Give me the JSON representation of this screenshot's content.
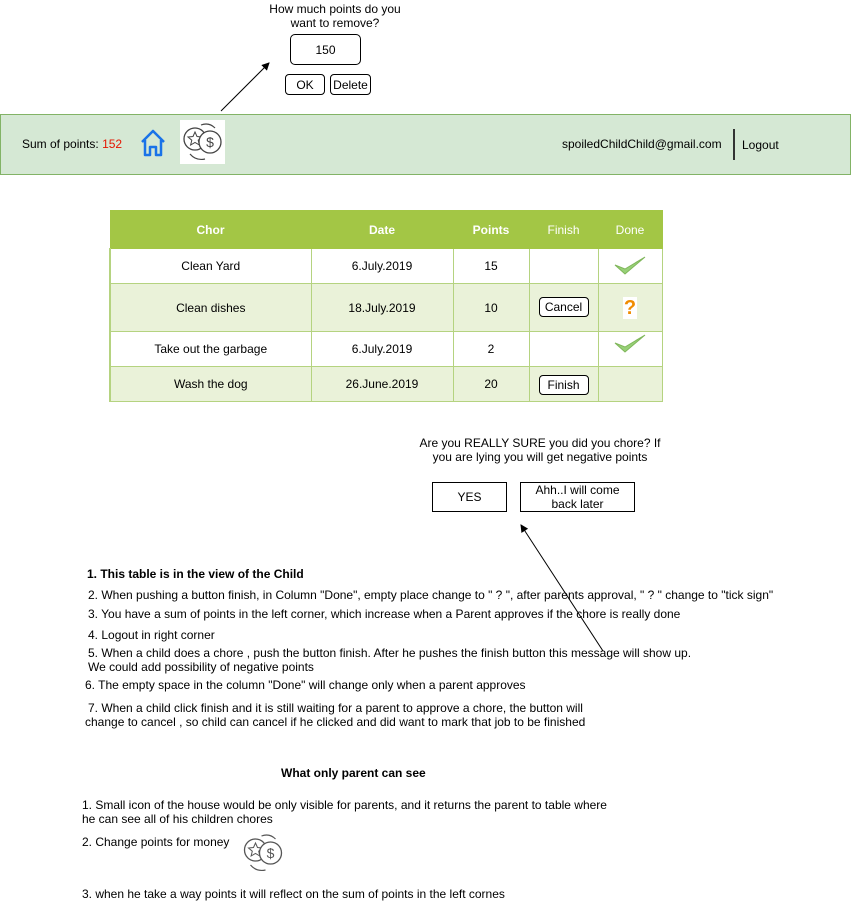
{
  "popup": {
    "question_line1": "How much points do you",
    "question_line2": "want to remove?",
    "value": "150",
    "ok_label": "OK",
    "delete_label": "Delete"
  },
  "header": {
    "sum_label": "Sum of points:",
    "sum_value": "152",
    "email": "spoiledChildChild@gmail.com",
    "logout_label": "Logout"
  },
  "table": {
    "columns": [
      "Chor",
      "Date",
      "Points",
      "Finish",
      "Done"
    ],
    "rows": [
      {
        "chore": "Clean Yard",
        "date": "6.July.2019",
        "points": "15",
        "finish": "",
        "done": "tick"
      },
      {
        "chore": "Clean dishes",
        "date": "18.July.2019",
        "points": "10",
        "finish": "Cancel",
        "done": "question"
      },
      {
        "chore": "Take out the garbage",
        "date": "6.July.2019",
        "points": "2",
        "finish": "",
        "done": "tick"
      },
      {
        "chore": "Wash the dog",
        "date": "26.June.2019",
        "points": "20",
        "finish": "Finish",
        "done": ""
      }
    ],
    "question_mark": "?"
  },
  "confirm": {
    "line1": "Are you REALLY SURE you did you chore? If",
    "line2": "you are lying you will get negative points",
    "yes_label": "YES",
    "later_line1": "Ahh..I will come",
    "later_line2": "back later"
  },
  "notes": {
    "n1": "1.  This table is in the view of the  Child",
    "n2": "2. When pushing a button finish, in Column \"Done\", empty place change to \" ? \", after parents approval, \" ? \" change to \"tick sign\"",
    "n3": "3. You have a sum of points in the left corner, which increase when a Parent approves if the chore is really done",
    "n4": "4. Logout in right corner",
    "n5a": "5.  When a child does a chore , push the button finish. After he pushes the finish button this message will show up.",
    "n5b": "We could add possibility of negative points",
    "n6": "6. The empty space in the column \"Done\" will change only when a parent approves",
    "n7a": "7. When a child click finish and it is still waiting for a parent to approve a chore, the button will",
    "n7b": "change to cancel , so child can cancel if he clicked and did want to mark that job to be finished"
  },
  "parent": {
    "heading": "What only parent can see",
    "p1a": "1. Small icon of the house would be only visible for parents, and it returns the parent to table where",
    "p1b": "he can see all of his children chores",
    "p2": "2. Change points for money",
    "p3": "3. when he take a way points it will reflect on the sum of points in the left cornes"
  },
  "colors": {
    "header_bg": "#d5e8d4",
    "header_border": "#82b366",
    "table_header": "#a3c645",
    "row_alt": "#eaf2d9",
    "sum_value": "#e51400",
    "house_icon": "#1a73e8",
    "tick": "#97d077",
    "question": "#f08c00"
  },
  "icons": [
    "house-icon",
    "exchange-points-money-icon",
    "check-icon",
    "question-icon",
    "arrow-icon"
  ]
}
